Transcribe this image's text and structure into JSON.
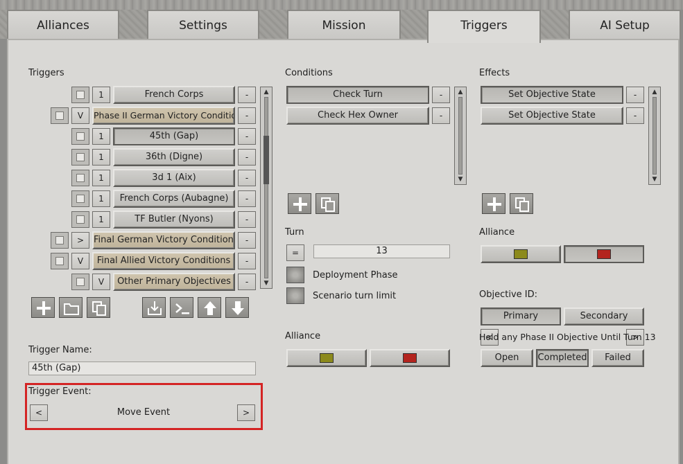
{
  "tabs": [
    {
      "label": "Alliances"
    },
    {
      "label": "Settings"
    },
    {
      "label": "Mission"
    },
    {
      "label": "Triggers"
    },
    {
      "label": "AI Setup"
    }
  ],
  "triggers": {
    "heading": "Triggers",
    "remove_label": "-",
    "rows": [
      {
        "prefix": "1",
        "label": "French Corps"
      },
      {
        "prefix": "V",
        "label": "Phase II German Victory Conditions"
      },
      {
        "prefix": "1",
        "label": "45th (Gap)"
      },
      {
        "prefix": "1",
        "label": "36th (Digne)"
      },
      {
        "prefix": "1",
        "label": "3d 1 (Aix)"
      },
      {
        "prefix": "1",
        "label": "French Corps (Aubagne)"
      },
      {
        "prefix": "1",
        "label": "TF Butler (Nyons)"
      },
      {
        "prefix": ">",
        "label": "Final German Victory Conditions"
      },
      {
        "prefix": "V",
        "label": "Final Allied Victory Conditions"
      },
      {
        "prefix": "V",
        "label": "Other Primary Objectives"
      }
    ],
    "name_label": "Trigger Name:",
    "name_value": "45th (Gap)",
    "event_label": "Trigger Event:",
    "event_value": "Move Event",
    "prev": "<",
    "next": ">"
  },
  "conditions": {
    "heading": "Conditions",
    "items": [
      {
        "label": "Check Turn"
      },
      {
        "label": "Check Hex Owner"
      }
    ],
    "remove_label": "-",
    "turn_label": "Turn",
    "operator": "=",
    "turn_value": "13",
    "deployment_label": "Deployment Phase",
    "scenario_limit_label": "Scenario turn limit",
    "alliance_label": "Alliance"
  },
  "effects": {
    "heading": "Effects",
    "items": [
      {
        "label": "Set Objective State"
      },
      {
        "label": "Set Objective State"
      }
    ],
    "remove_label": "-",
    "alliance_label": "Alliance",
    "objective_id_label": "Objective ID:",
    "primary": "Primary",
    "secondary": "Secondary",
    "objective_name": "Hold any Phase II Objective Until Turn 13",
    "prev": "<",
    "next": ">",
    "states": [
      {
        "label": "Open"
      },
      {
        "label": "Completed"
      },
      {
        "label": "Failed"
      }
    ]
  },
  "colors": {
    "allied_olive": "#8c8a1c",
    "axis_red": "#b3241e",
    "highlight": "#d42424"
  }
}
